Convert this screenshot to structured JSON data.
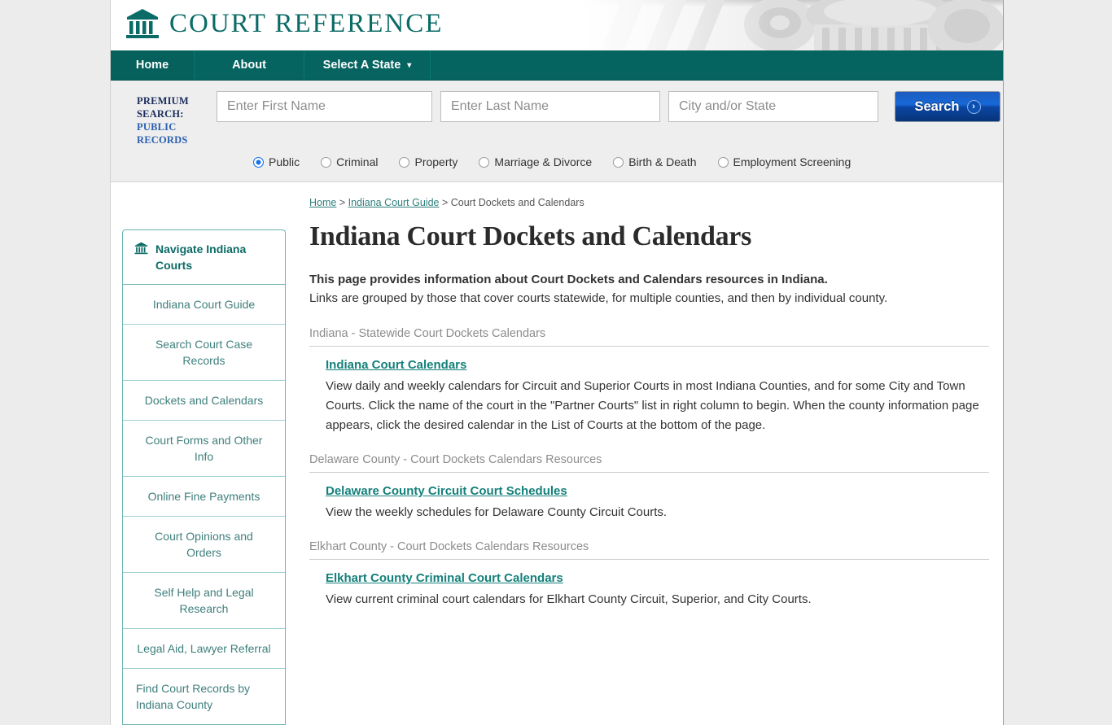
{
  "site": {
    "brand": "COURT REFERENCE",
    "logo_icon": "courthouse-icon"
  },
  "nav": {
    "items": [
      {
        "label": "Home",
        "id": "home"
      },
      {
        "label": "About",
        "id": "about"
      },
      {
        "label": "Select A State",
        "id": "select-a-state",
        "caret": "▾"
      }
    ]
  },
  "premium_search": {
    "label_line1": "PREMIUM",
    "label_line2": "SEARCH:",
    "label_link1": "PUBLIC",
    "label_link2": "RECORDS",
    "first_name_placeholder": "Enter First Name",
    "first_name_value": "",
    "last_name_placeholder": "Enter Last Name",
    "last_name_value": "",
    "city_state_placeholder": "City and/or State",
    "city_state_value": "",
    "search_button": "Search",
    "search_button_icon": "chevron-right-icon",
    "radio_options": [
      {
        "label": "Public",
        "selected": true
      },
      {
        "label": "Criminal",
        "selected": false
      },
      {
        "label": "Property",
        "selected": false
      },
      {
        "label": "Marriage & Divorce",
        "selected": false
      },
      {
        "label": "Birth & Death",
        "selected": false
      },
      {
        "label": "Employment Screening",
        "selected": false
      }
    ]
  },
  "sidebar": {
    "header_icon": "courthouse-icon",
    "header_title": "Navigate Indiana Courts",
    "items": [
      {
        "label": "Indiana Court Guide"
      },
      {
        "label": "Search Court Case Records"
      },
      {
        "label": "Dockets and Calendars"
      },
      {
        "label": "Court Forms and Other Info"
      },
      {
        "label": "Online Fine Payments"
      },
      {
        "label": "Court Opinions and Orders"
      },
      {
        "label": "Self Help and Legal Research"
      },
      {
        "label": "Legal Aid, Lawyer Referral"
      },
      {
        "label": "Find Court Records by Indiana County"
      }
    ]
  },
  "breadcrumb": {
    "home": "Home",
    "sep1": " > ",
    "guide": "Indiana Court Guide",
    "sep2": " > ",
    "current": "Court Dockets and Calendars"
  },
  "main": {
    "title": "Indiana Court Dockets and Calendars",
    "intro_strong": "This page provides information about Court Dockets and Calendars resources in Indiana.",
    "intro_sub": "Links are grouped by those that cover courts statewide, for multiple counties, and then by individual county.",
    "sections": [
      {
        "heading": "Indiana - Statewide Court Dockets Calendars",
        "resources": [
          {
            "link": "Indiana Court Calendars",
            "description": "View daily and weekly calendars for Circuit and Superior Courts in most Indiana Counties, and for some City and Town Courts. Click the name of the court in the \"Partner Courts\" list in right column to begin. When the county information page appears, click the desired calendar in the List of Courts at the bottom of the page."
          }
        ]
      },
      {
        "heading": "Delaware County - Court Dockets Calendars Resources",
        "resources": [
          {
            "link": "Delaware County Circuit Court Schedules",
            "description": "View the weekly schedules for Delaware County Circuit Courts."
          }
        ]
      },
      {
        "heading": "Elkhart County - Court Dockets Calendars Resources",
        "resources": [
          {
            "link": "Elkhart County Criminal Court Calendars",
            "description": "View current criminal court calendars for Elkhart County Circuit, Superior, and City Courts."
          }
        ]
      }
    ]
  },
  "colors": {
    "brand_teal": "#0b6b66",
    "nav_teal": "#066460",
    "link_teal": "#14807b",
    "premium_navy": "#1b2d5b",
    "premium_link_blue": "#2a5fb0",
    "search_blue": "#1769d8",
    "radio_blue": "#1673e8"
  }
}
